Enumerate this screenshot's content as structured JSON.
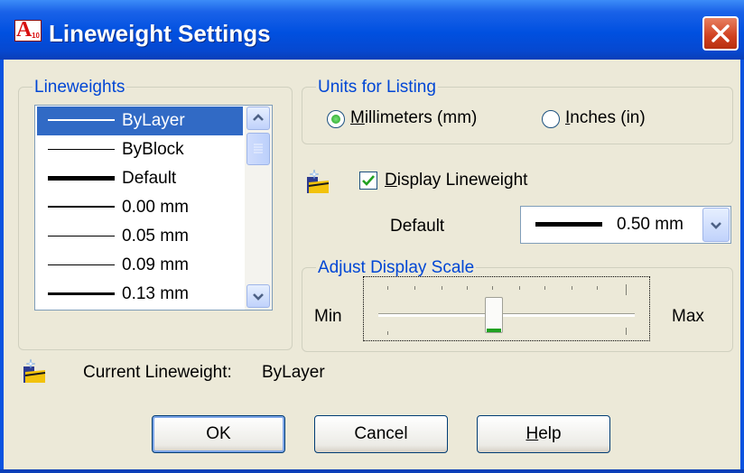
{
  "window": {
    "title": "Lineweight Settings",
    "app_icon_letter": "A",
    "app_icon_version": "10"
  },
  "lineweights_group": {
    "label": "Lineweights",
    "items": [
      {
        "label": "ByLayer",
        "selected": true
      },
      {
        "label": "ByBlock",
        "selected": false
      },
      {
        "label": "Default",
        "selected": false
      },
      {
        "label": "0.00 mm",
        "selected": false
      },
      {
        "label": "0.05 mm",
        "selected": false
      },
      {
        "label": "0.09 mm",
        "selected": false
      },
      {
        "label": "0.13 mm",
        "selected": false
      }
    ]
  },
  "units_group": {
    "label": "Units for Listing",
    "mm_option": {
      "accel": "M",
      "rest": "illimeters (mm)",
      "selected": true
    },
    "in_option": {
      "accel": "I",
      "rest": "nches (in)",
      "selected": false
    }
  },
  "display_lineweight": {
    "accel": "D",
    "rest": "isplay Lineweight",
    "checked": true
  },
  "default_field": {
    "label": "Default",
    "value": "0.50 mm"
  },
  "scale_group": {
    "label": "Adjust Display Scale",
    "min_label": "Min",
    "max_label": "Max",
    "level": 0.45
  },
  "current": {
    "label": "Current Lineweight:",
    "value": "ByLayer"
  },
  "buttons": {
    "ok": "OK",
    "cancel": "Cancel",
    "help_accel": "H",
    "help_rest": "elp"
  },
  "colors": {
    "title_bar": "#0050e0",
    "accent": "#316ac5",
    "group_label": "#0046d5",
    "close": "#d04020"
  }
}
